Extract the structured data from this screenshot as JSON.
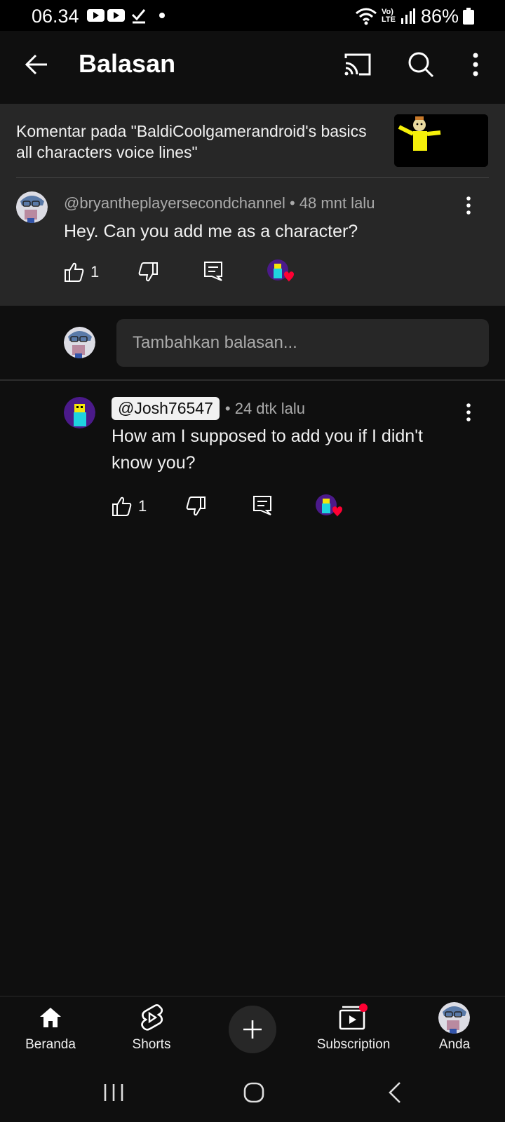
{
  "status_bar": {
    "time": "06.34",
    "battery": "86%",
    "network": "Vo) LTE"
  },
  "app_bar": {
    "title": "Balasan",
    "back_icon": "arrow-left-icon",
    "cast_icon": "cast-icon",
    "search_icon": "search-icon",
    "more_icon": "more-vert-icon"
  },
  "original_comment": {
    "video_ref": "Komentar pada \"BaldiCoolgamerandroid's basics all characters voice lines\"",
    "author": "@bryantheplayersecondchannel",
    "time": "• 48 mnt lalu",
    "text": "Hey. Can you add me as a character?",
    "likes": "1"
  },
  "reply_input": {
    "placeholder": "Tambahkan balasan..."
  },
  "replies": [
    {
      "author": "@Josh76547",
      "time": "• 24 dtk lalu",
      "text": "How am I supposed to add you if I didn't know you?",
      "likes": "1"
    }
  ],
  "bottom_nav": {
    "home": "Beranda",
    "shorts": "Shorts",
    "subscriptions": "Subscription",
    "you": "Anda"
  },
  "colors": {
    "background": "#0f0f0f",
    "surface": "#272727",
    "text_primary": "#f1f1f1",
    "text_secondary": "#aaaaaa",
    "heart": "#ff0033",
    "notification_dot": "#ff0033"
  }
}
